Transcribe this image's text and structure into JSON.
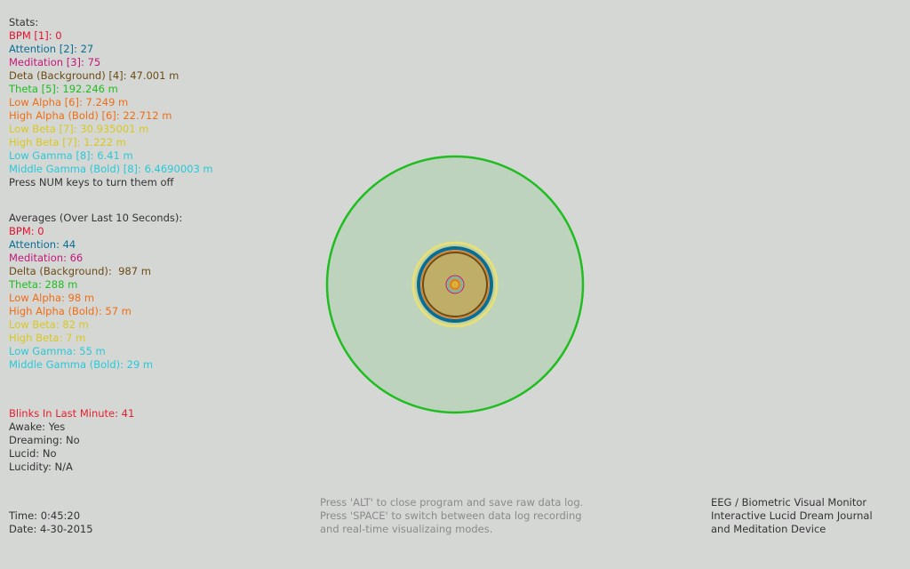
{
  "colors": {
    "background": "#d5d7d5",
    "default_text": "#333333",
    "instruction_text": "#8a8a8a",
    "bpm": "#e8102e",
    "attention": "#0a6e94",
    "meditation": "#c2187a",
    "delta": "#6b4b14",
    "theta": "#1fbd1f",
    "low_alpha": "#f06d14",
    "high_alpha": "#f06d14",
    "low_beta": "#d8c81e",
    "high_beta": "#d8c81e",
    "low_gamma": "#28c8d6",
    "middle_gamma": "#28c8d6",
    "blinks": "#e8202e"
  },
  "stats": {
    "header": "Stats:",
    "bpm": {
      "label": "BPM [1]:",
      "value": "0"
    },
    "attention": {
      "label": "Attention [2]:",
      "value": "27"
    },
    "meditation": {
      "label": "Meditation [3]:",
      "value": "75"
    },
    "delta": {
      "label": "Deta (Background) [4]:",
      "value": "47.001 m"
    },
    "theta": {
      "label": "Theta [5]:",
      "value": "192.246 m"
    },
    "low_alpha": {
      "label": "Low Alpha [6]:",
      "value": "7.249 m"
    },
    "high_alpha": {
      "label": "High Alpha (Bold) [6]:",
      "value": "22.712 m"
    },
    "low_beta": {
      "label": "Low Beta [7]:",
      "value": "30.935001 m"
    },
    "high_beta": {
      "label": "High Beta [7]:",
      "value": "1.222 m"
    },
    "low_gamma": {
      "label": "Low Gamma [8]:",
      "value": "6.41 m"
    },
    "middle_gamma": {
      "label": "Middle Gamma (Bold) [8]:",
      "value": "6.4690003 m"
    },
    "hint": "Press NUM keys to turn them off"
  },
  "averages": {
    "header": "Averages (Over Last 10 Seconds):",
    "bpm": {
      "label": "BPM:",
      "value": "0"
    },
    "attention": {
      "label": "Attention:",
      "value": "44"
    },
    "meditation": {
      "label": "Meditation:",
      "value": "66"
    },
    "delta": {
      "label": "Delta (Background):",
      "value": " 987 m"
    },
    "theta": {
      "label": "Theta:",
      "value": "288 m"
    },
    "low_alpha": {
      "label": "Low Alpha:",
      "value": "98 m"
    },
    "high_alpha": {
      "label": "High Alpha (Bold):",
      "value": "57 m"
    },
    "low_beta": {
      "label": "Low Beta:",
      "value": "82 m"
    },
    "high_beta": {
      "label": "High Beta:",
      "value": "7 m"
    },
    "low_gamma": {
      "label": "Low Gamma:",
      "value": "55 m"
    },
    "middle_gamma": {
      "label": "Middle Gamma (Bold):",
      "value": "29 m"
    }
  },
  "state": {
    "blinks": {
      "label": "Blinks In Last Minute:",
      "value": "41"
    },
    "awake": {
      "label": "Awake:",
      "value": "Yes"
    },
    "dreaming": {
      "label": "Dreaming:",
      "value": "No"
    },
    "lucid": {
      "label": "Lucid:",
      "value": "No"
    },
    "lucidity": {
      "label": "Lucidity:",
      "value": "N/A"
    }
  },
  "datetime": {
    "time": {
      "label": "Time:",
      "value": "0:45:20"
    },
    "date": {
      "label": "Date:",
      "value": "4-30-2015"
    }
  },
  "instructions": [
    "Press 'ALT' to close program and save raw data log.",
    "Press 'SPACE' to switch between data log recording",
    "and real-time visualizaing modes."
  ],
  "app_info": [
    "EEG / Biometric Visual Monitor",
    "Interactive Lucid Dream Journal",
    "and Meditation Device"
  ],
  "visualizer": {
    "rings": [
      {
        "band": "theta",
        "fill": "rgba(31,189,31,0.13)",
        "stroke": "#1fbd1f",
        "stroke_fill_weight": "normal"
      },
      {
        "band": "low_beta",
        "fill": "rgba(216,200,30,0.18)",
        "stroke": "#e6df7a",
        "stroke_fill_weight": "bold"
      },
      {
        "band": "attention",
        "fill": "none",
        "stroke": "#0a6e94",
        "stroke_fill_weight": "bold"
      },
      {
        "band": "high_alpha",
        "fill": "rgba(240,109,20,0.15)",
        "stroke": "#f06d14",
        "stroke_fill_weight": "normal"
      },
      {
        "band": "delta",
        "fill": "rgba(180,150,60,0.45)",
        "stroke": "#6b4b14",
        "stroke_fill_weight": "normal"
      },
      {
        "band": "meditation",
        "fill": "none",
        "stroke": "#c2187a",
        "stroke_fill_weight": "normal"
      },
      {
        "band": "low_gamma",
        "fill": "none",
        "stroke": "#28c8d6",
        "stroke_fill_weight": "normal"
      },
      {
        "band": "low_alpha",
        "fill": "rgba(240,109,20,0.4)",
        "stroke": "#f06d14",
        "stroke_fill_weight": "normal"
      },
      {
        "band": "high_beta",
        "fill": "rgba(216,200,30,0.6)",
        "stroke": "#d8c81e",
        "stroke_fill_weight": "normal"
      }
    ]
  }
}
